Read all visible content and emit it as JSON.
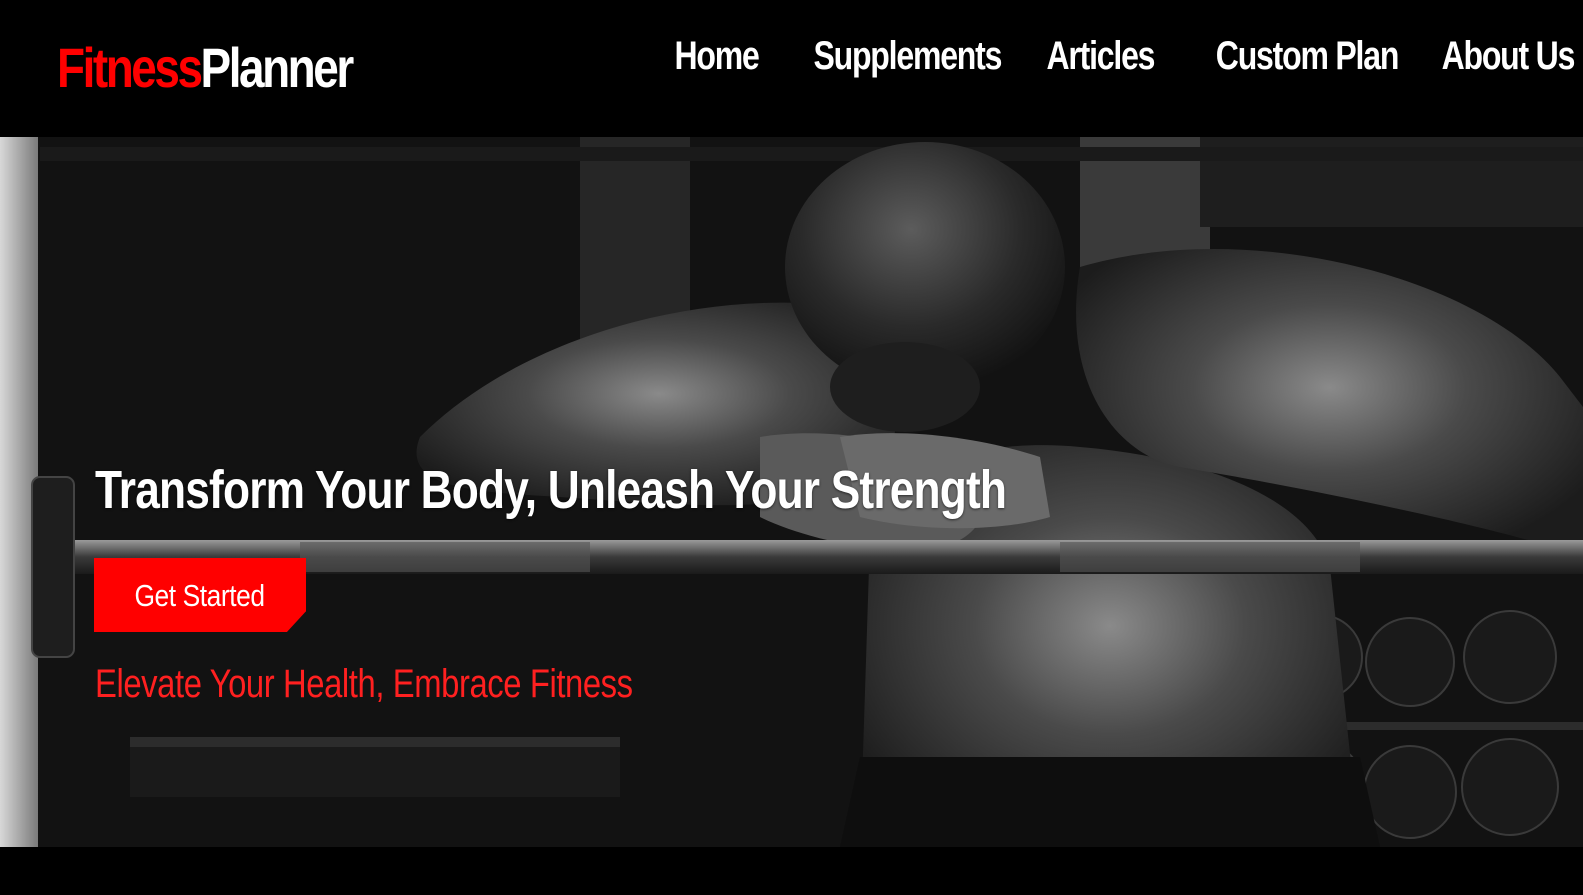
{
  "brand": {
    "name_part_1": "Fitness",
    "name_part_2": "Planner",
    "accent_color": "#ff0000"
  },
  "nav": {
    "items": [
      {
        "label": "Home"
      },
      {
        "label": "Supplements"
      },
      {
        "label": "Articles"
      },
      {
        "label": "Custom Plan"
      },
      {
        "label": "About Us"
      }
    ]
  },
  "hero": {
    "title": "Transform Your Body, Unleash Your Strength",
    "cta_label": "Get Started",
    "tagline": "Elevate Your Health, Embrace Fitness",
    "image_subject": "athlete-leaning-on-barbell"
  }
}
